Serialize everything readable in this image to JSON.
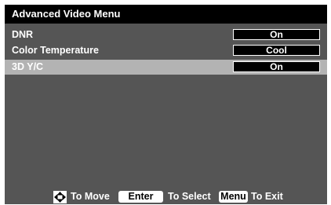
{
  "title": "Advanced Video Menu",
  "rows": [
    {
      "label": "DNR",
      "value": "On",
      "selected": false
    },
    {
      "label": "Color Temperature",
      "value": "Cool",
      "selected": false
    },
    {
      "label": "3D Y/C",
      "value": "On",
      "selected": true
    }
  ],
  "help": {
    "move_icon": "dpad-arrows-icon",
    "move_text": "To Move",
    "enter_key": "Enter",
    "select_text": "To Select",
    "menu_key": "Menu",
    "exit_text": "To Exit"
  },
  "colors": {
    "background": "#555555",
    "selected_row": "#b3b3b3",
    "title_bar": "#000000",
    "text": "#ffffff"
  }
}
